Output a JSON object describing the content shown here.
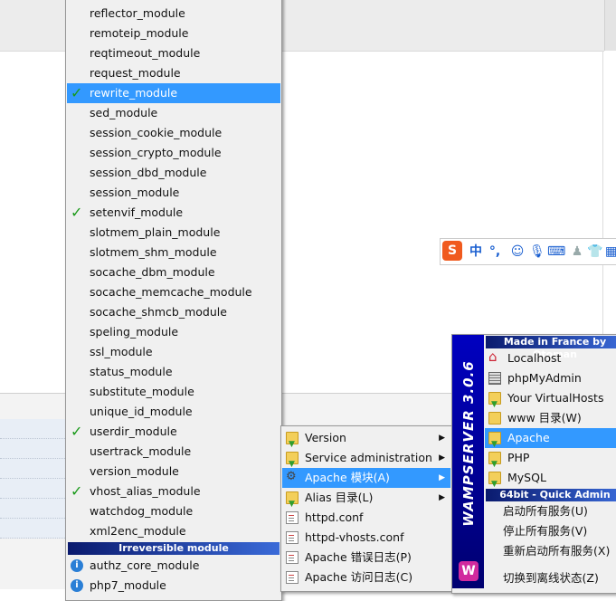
{
  "ime_toolbar": {
    "logo": "S",
    "mode_char": "中",
    "punct": "°,",
    "icons": [
      "emoji-icon",
      "mic-icon",
      "keyboard-icon",
      "skin-icon",
      "shirt-icon",
      "grid-icon"
    ]
  },
  "modules_menu": {
    "items": [
      {
        "label": "reflector_module",
        "checked": false
      },
      {
        "label": "remoteip_module",
        "checked": false
      },
      {
        "label": "reqtimeout_module",
        "checked": false
      },
      {
        "label": "request_module",
        "checked": false
      },
      {
        "label": "rewrite_module",
        "checked": true,
        "selected": true
      },
      {
        "label": "sed_module",
        "checked": false
      },
      {
        "label": "session_cookie_module",
        "checked": false
      },
      {
        "label": "session_crypto_module",
        "checked": false
      },
      {
        "label": "session_dbd_module",
        "checked": false
      },
      {
        "label": "session_module",
        "checked": false
      },
      {
        "label": "setenvif_module",
        "checked": true
      },
      {
        "label": "slotmem_plain_module",
        "checked": false
      },
      {
        "label": "slotmem_shm_module",
        "checked": false
      },
      {
        "label": "socache_dbm_module",
        "checked": false
      },
      {
        "label": "socache_memcache_module",
        "checked": false
      },
      {
        "label": "socache_shmcb_module",
        "checked": false
      },
      {
        "label": "speling_module",
        "checked": false
      },
      {
        "label": "ssl_module",
        "checked": false
      },
      {
        "label": "status_module",
        "checked": false
      },
      {
        "label": "substitute_module",
        "checked": false
      },
      {
        "label": "unique_id_module",
        "checked": false
      },
      {
        "label": "userdir_module",
        "checked": true
      },
      {
        "label": "usertrack_module",
        "checked": false
      },
      {
        "label": "version_module",
        "checked": false
      },
      {
        "label": "vhost_alias_module",
        "checked": true
      },
      {
        "label": "watchdog_module",
        "checked": false
      },
      {
        "label": "xml2enc_module",
        "checked": false
      }
    ],
    "irreversible_header": "Irreversible module",
    "irreversible_items": [
      {
        "label": "authz_core_module"
      },
      {
        "label": "php7_module"
      }
    ]
  },
  "apache_menu": {
    "items": [
      {
        "label": "Version",
        "submenu": true,
        "icon": "folder-arrow-icon"
      },
      {
        "label": "Service administration",
        "submenu": true,
        "icon": "folder-arrow-icon"
      },
      {
        "label": "Apache 模块(A)",
        "submenu": true,
        "icon": "gear-icon",
        "selected": true
      },
      {
        "label": "Alias 目录(L)",
        "submenu": true,
        "icon": "folder-arrow-icon"
      },
      {
        "label": "httpd.conf",
        "submenu": false,
        "icon": "document-icon"
      },
      {
        "label": "httpd-vhosts.conf",
        "submenu": false,
        "icon": "document-icon"
      },
      {
        "label": "Apache 错误日志(P)",
        "submenu": false,
        "icon": "document-icon"
      },
      {
        "label": "Apache 访问日志(C)",
        "submenu": false,
        "icon": "document-icon"
      }
    ]
  },
  "wamp_menu": {
    "sidebar_text": "WAMPSERVER 3.0.6",
    "logo": "W",
    "header": "Made in France by Otoman",
    "items": [
      {
        "label": "Localhost",
        "icon": "home-icon"
      },
      {
        "label": "phpMyAdmin",
        "icon": "grid-icon"
      },
      {
        "label": "Your VirtualHosts",
        "icon": "folder-arrow-icon"
      },
      {
        "label": "www 目录(W)",
        "icon": "folder-icon"
      },
      {
        "label": "Apache",
        "icon": "folder-arrow-icon",
        "selected": true
      },
      {
        "label": "PHP",
        "icon": "folder-arrow-icon"
      },
      {
        "label": "MySQL",
        "icon": "folder-arrow-icon"
      }
    ],
    "quick_admin_header": "64bit - Quick Admin",
    "admin_items": [
      {
        "label": "启动所有服务(U)"
      },
      {
        "label": "停止所有服务(V)"
      },
      {
        "label": "重新启动所有服务(X)"
      },
      {
        "label": "切换到离线状态(Z)"
      }
    ]
  }
}
